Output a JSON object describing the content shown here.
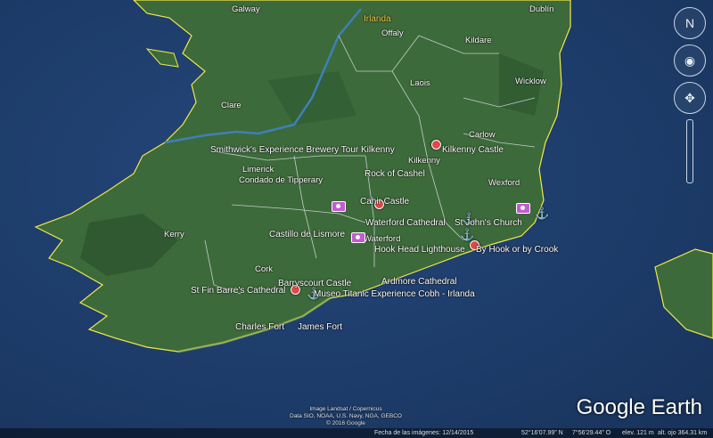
{
  "country_label": "Irlanda",
  "places": [
    {
      "id": "galway",
      "label": "Galway"
    },
    {
      "id": "offaly",
      "label": "Offaly"
    },
    {
      "id": "kildare",
      "label": "Kildare"
    },
    {
      "id": "dublin",
      "label": "Dublín"
    },
    {
      "id": "laois",
      "label": "Laois"
    },
    {
      "id": "wicklow",
      "label": "Wicklow"
    },
    {
      "id": "clare",
      "label": "Clare"
    },
    {
      "id": "carlow",
      "label": "Carlow"
    },
    {
      "id": "kilkenny",
      "label": "Kilkenny"
    },
    {
      "id": "limerick",
      "label": "Limerick"
    },
    {
      "id": "tipperary",
      "label": "Condado de Tipperary"
    },
    {
      "id": "wexford",
      "label": "Wexford"
    },
    {
      "id": "kerry",
      "label": "Kerry"
    },
    {
      "id": "waterford",
      "label": "Waterford"
    },
    {
      "id": "cork",
      "label": "Cork"
    }
  ],
  "pois": [
    {
      "id": "smithwicks",
      "label": "Smithwick's Experience Brewery Tour Kilkenny"
    },
    {
      "id": "kilkenny-castle",
      "label": "Kilkenny Castle"
    },
    {
      "id": "rock-of-cashel",
      "label": "Rock of Cashel"
    },
    {
      "id": "cahir-castle",
      "label": "Cahir Castle"
    },
    {
      "id": "waterford-cathedral",
      "label": "Waterford Cathedral"
    },
    {
      "id": "st-johns-church",
      "label": "St John's Church"
    },
    {
      "id": "castillo-lismore",
      "label": "Castillo de Lismore"
    },
    {
      "id": "hook-head",
      "label": "Hook Head Lighthouse"
    },
    {
      "id": "by-hook-or-crook",
      "label": "By Hook or by Crook"
    },
    {
      "id": "barryscourt",
      "label": "Barryscourt Castle"
    },
    {
      "id": "ardmore",
      "label": "Ardmore Cathedral"
    },
    {
      "id": "st-fin-barre",
      "label": "St Fin Barre's Cathedral"
    },
    {
      "id": "museo-titanic",
      "label": "Museo Titanic Experience Cobh - Irlanda"
    },
    {
      "id": "charles-fort",
      "label": "Charles Fort"
    },
    {
      "id": "james-fort",
      "label": "James Fort"
    }
  ],
  "attribution": [
    "Image Landsat / Copernicus",
    "Data SIO, NOAA, U.S. Navy, NGA, GEBCO",
    "© 2016 Google"
  ],
  "brand": "Google Earth",
  "status_bar": {
    "imagery_date": "Fecha de las imágenes: 12/14/2015",
    "lat": "52°16'07.99\" N",
    "lon": "7°56'29.44\" O",
    "elev": "elev. 121 m",
    "eye_alt": "alt. ojo 364.31 km"
  },
  "nav_icons": [
    "compass-icon",
    "look-joystick-icon",
    "move-joystick-icon",
    "zoom-slider-icon"
  ],
  "colors": {
    "ocean": "#1d3b63",
    "land": "#3d6a3a",
    "border": "#f1e84a",
    "label": "#ffffff",
    "marker": "#e24848"
  }
}
